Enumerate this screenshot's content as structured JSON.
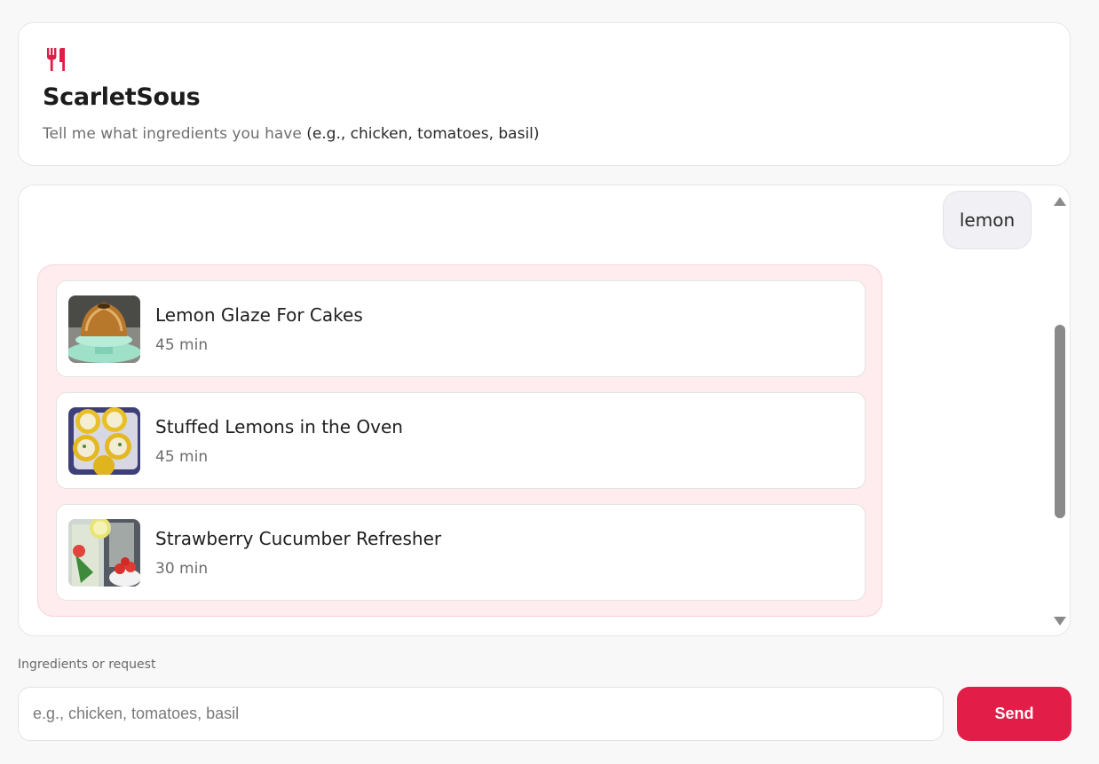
{
  "app": {
    "title": "ScarletSous",
    "subtitle_prefix": "Tell me what ingredients you have",
    "subtitle_example": "(e.g., chicken, tomatoes, basil)",
    "logo_icon": "utensils-icon",
    "accent_color": "#e11d48"
  },
  "chat": {
    "user_message": "lemon",
    "results_bg": "#ffecee",
    "recipes": [
      {
        "title": "Lemon Glaze For Cakes",
        "time": "45 min",
        "image": "lemon-glaze-cake-thumbnail"
      },
      {
        "title": "Stuffed Lemons in the Oven",
        "time": "45 min",
        "image": "stuffed-lemons-thumbnail"
      },
      {
        "title": "Strawberry Cucumber Refresher",
        "time": "30 min",
        "image": "strawberry-refresher-thumbnail"
      }
    ],
    "scroll_position": 0.55
  },
  "composer": {
    "label": "Ingredients or request",
    "value": "",
    "placeholder": "e.g., chicken, tomatoes, basil",
    "send_label": "Send"
  }
}
